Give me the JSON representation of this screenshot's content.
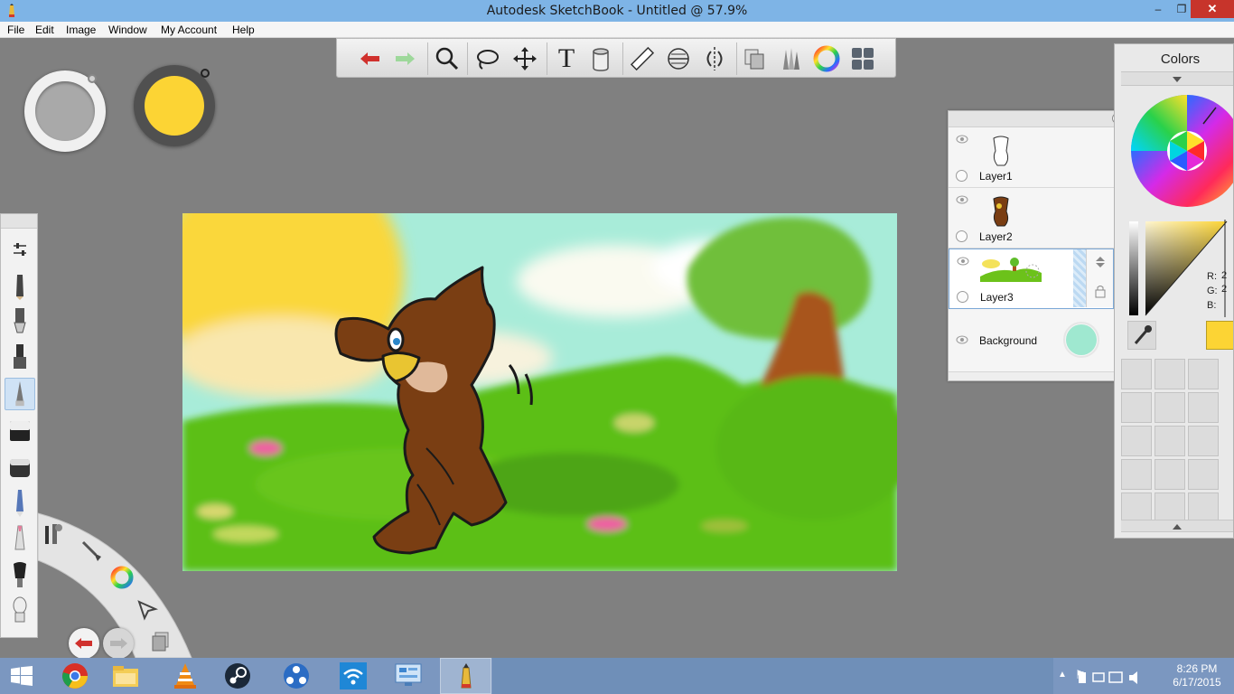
{
  "window": {
    "title": "Autodesk SketchBook - Untitled @ 57.9%",
    "minimize_glyph": "–",
    "maximize_glyph": "❐",
    "close_glyph": "✕"
  },
  "menu": [
    "File",
    "Edit",
    "Image",
    "Window",
    "My Account",
    "Help"
  ],
  "toolbar": {
    "icons": [
      "undo-icon",
      "redo-icon",
      "zoom-icon",
      "lasso-icon",
      "move-icon",
      "text-icon",
      "fill-icon",
      "ruler-icon",
      "ellipse-icon",
      "symmetry-icon",
      "copy-paste-icon",
      "brush-set-icon",
      "color-wheel-icon",
      "layout-icon"
    ],
    "text_glyph": "T"
  },
  "pucks": {
    "left_color": "#a9a9a9",
    "right_color": "#fcd434"
  },
  "left_tools": [
    "brush-properties-icon",
    "pencil-icon",
    "inking-pen-icon",
    "marker-icon",
    "airbrush-icon",
    "eraser-icon",
    "hard-eraser-icon",
    "ballpoint-icon",
    "chisel-marker-icon",
    "paint-brush-icon",
    "smudge-icon"
  ],
  "layers": {
    "items": [
      {
        "name": "Layer1"
      },
      {
        "name": "Layer2"
      },
      {
        "name": "Layer3"
      },
      {
        "name": "Background"
      }
    ],
    "background_color": "#9fe8d0"
  },
  "colors": {
    "title": "Colors",
    "r_label": "R:",
    "g_label": "G:",
    "b_label": "B:",
    "r_value": "2",
    "g_value": "2",
    "current_color": "#fcd434"
  },
  "taskbar": {
    "apps": [
      "start-icon",
      "chrome-icon",
      "file-explorer-icon",
      "vlc-icon",
      "steam-icon",
      "network-hub-icon",
      "wifi-app-icon",
      "control-panel-icon",
      "sketchbook-icon"
    ],
    "time": "8:26 PM",
    "date": "6/17/2015",
    "tray_chevron": "▲",
    "tray_flag": "⚑"
  }
}
